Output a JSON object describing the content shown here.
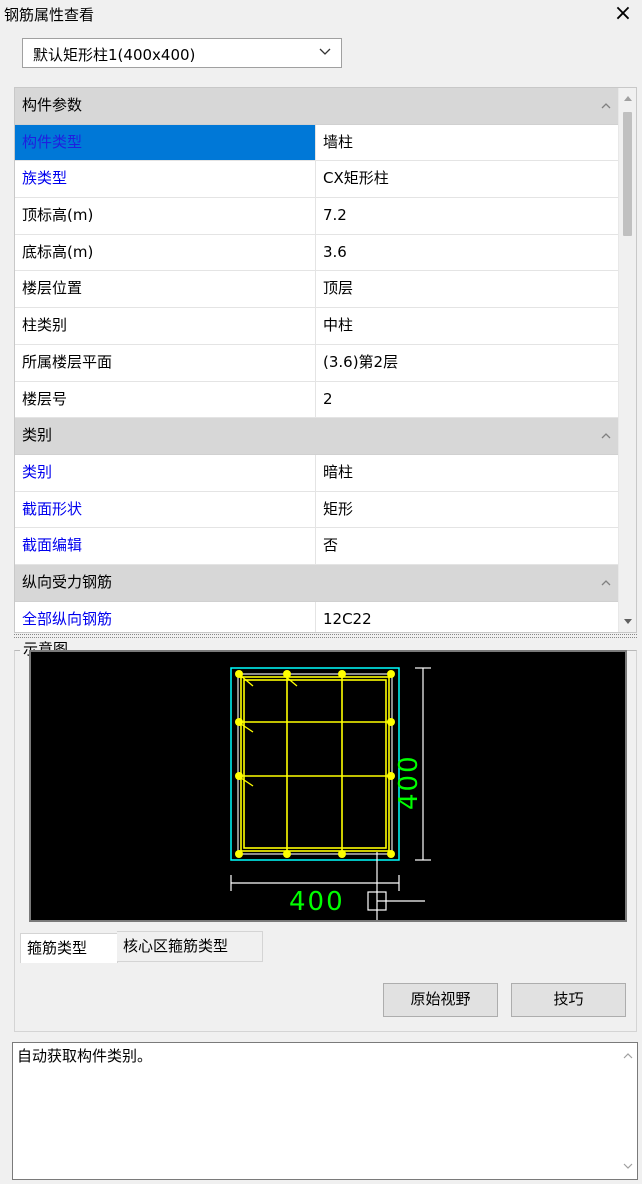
{
  "window": {
    "title": "钢筋属性查看",
    "close_icon": "×"
  },
  "component_select": {
    "value": "默认矩形柱1(400x400)"
  },
  "property_grid": {
    "rows": [
      {
        "kind": "category",
        "name": "构件参数"
      },
      {
        "kind": "prop",
        "name": "构件类型",
        "value": "墙柱",
        "style": "selected"
      },
      {
        "kind": "prop",
        "name": "族类型",
        "value": "CX矩形柱",
        "style": "blue"
      },
      {
        "kind": "prop",
        "name": "顶标高(m)",
        "value": "7.2",
        "style": "normal"
      },
      {
        "kind": "prop",
        "name": "底标高(m)",
        "value": "3.6",
        "style": "normal"
      },
      {
        "kind": "prop",
        "name": "楼层位置",
        "value": "顶层",
        "style": "normal"
      },
      {
        "kind": "prop",
        "name": "柱类别",
        "value": "中柱",
        "style": "normal"
      },
      {
        "kind": "prop",
        "name": "所属楼层平面",
        "value": "(3.6)第2层",
        "style": "normal"
      },
      {
        "kind": "prop",
        "name": "楼层号",
        "value": "2",
        "style": "normal"
      },
      {
        "kind": "category",
        "name": "类别"
      },
      {
        "kind": "prop",
        "name": "类别",
        "value": "暗柱",
        "style": "blue"
      },
      {
        "kind": "prop",
        "name": "截面形状",
        "value": "矩形",
        "style": "blue"
      },
      {
        "kind": "prop",
        "name": "截面编辑",
        "value": "否",
        "style": "blue"
      },
      {
        "kind": "category",
        "name": "纵向受力钢筋"
      },
      {
        "kind": "prop",
        "name": "全部纵向钢筋",
        "value": "12C22",
        "style": "blue"
      }
    ]
  },
  "diagram": {
    "title": "示意图",
    "dim_width": "400",
    "dim_height": "400",
    "colors": {
      "outline": "#00ffff",
      "rebar": "#ffff00",
      "dim_line": "#ffffff",
      "dim_text": "#00ff00"
    }
  },
  "tabs": [
    {
      "label": "箍筋类型",
      "active": true
    },
    {
      "label": "核心区箍筋类型",
      "active": false
    }
  ],
  "buttons": {
    "original_view": "原始视野",
    "tips": "技巧"
  },
  "status": {
    "text": "自动获取构件类别。"
  }
}
